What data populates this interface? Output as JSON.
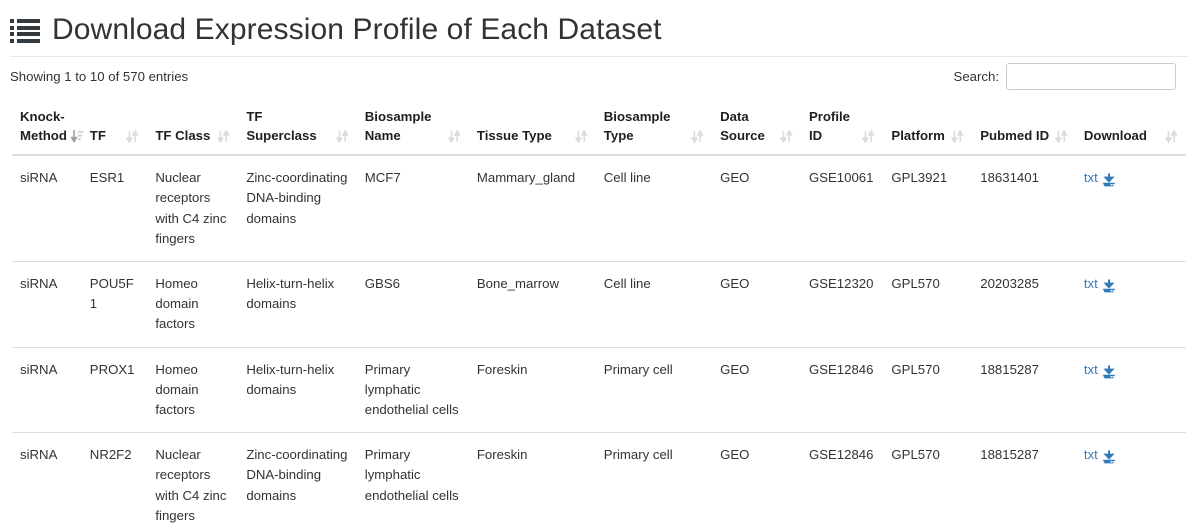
{
  "header": {
    "icon": "list-icon",
    "title": "Download Expression Profile of Each Dataset"
  },
  "table_controls": {
    "info": "Showing 1 to 10 of 570 entries",
    "search_label": "Search:",
    "search_value": "",
    "search_placeholder": ""
  },
  "table": {
    "columns": [
      {
        "label": "Knock-Method",
        "sort": "sort-amount-desc-icon",
        "sorted": true
      },
      {
        "label": "TF",
        "sort": "sort-icon",
        "sorted": false
      },
      {
        "label": "TF Class",
        "sort": "sort-icon",
        "sorted": false
      },
      {
        "label": "TF Superclass",
        "sort": "sort-icon",
        "sorted": false
      },
      {
        "label": "Biosample Name",
        "sort": "sort-icon",
        "sorted": false
      },
      {
        "label": "Tissue Type",
        "sort": "sort-icon",
        "sorted": false
      },
      {
        "label": "Biosample Type",
        "sort": "sort-icon",
        "sorted": false
      },
      {
        "label": "Data Source",
        "sort": "sort-icon",
        "sorted": false
      },
      {
        "label": "Profile ID",
        "sort": "sort-icon",
        "sorted": false
      },
      {
        "label": "Platform",
        "sort": "sort-icon",
        "sorted": false
      },
      {
        "label": "Pubmed ID",
        "sort": "sort-icon",
        "sorted": false
      },
      {
        "label": "Download",
        "sort": "sort-icon",
        "sorted": false
      }
    ],
    "rows": [
      {
        "knock_method": "siRNA",
        "tf": "ESR1",
        "tf_class": "Nuclear receptors with C4 zinc fingers",
        "tf_superclass": "Zinc-coordinating DNA-binding domains",
        "biosample_name": "MCF7",
        "tissue_type": "Mammary_gland",
        "biosample_type": "Cell line",
        "data_source": "GEO",
        "profile_id": "GSE10061",
        "platform": "GPL3921",
        "pubmed_id": "18631401",
        "download_label": "txt"
      },
      {
        "knock_method": "siRNA",
        "tf": "POU5F1",
        "tf_class": "Homeo domain factors",
        "tf_superclass": "Helix-turn-helix domains",
        "biosample_name": "GBS6",
        "tissue_type": "Bone_marrow",
        "biosample_type": "Cell line",
        "data_source": "GEO",
        "profile_id": "GSE12320",
        "platform": "GPL570",
        "pubmed_id": "20203285",
        "download_label": "txt"
      },
      {
        "knock_method": "siRNA",
        "tf": "PROX1",
        "tf_class": "Homeo domain factors",
        "tf_superclass": "Helix-turn-helix domains",
        "biosample_name": "Primary lymphatic endothelial cells",
        "tissue_type": "Foreskin",
        "biosample_type": "Primary cell",
        "data_source": "GEO",
        "profile_id": "GSE12846",
        "platform": "GPL570",
        "pubmed_id": "18815287",
        "download_label": "txt"
      },
      {
        "knock_method": "siRNA",
        "tf": "NR2F2",
        "tf_class": "Nuclear receptors with C4 zinc fingers",
        "tf_superclass": "Zinc-coordinating DNA-binding domains",
        "biosample_name": "Primary lymphatic endothelial cells",
        "tissue_type": "Foreskin",
        "biosample_type": "Primary cell",
        "data_source": "GEO",
        "profile_id": "GSE12846",
        "platform": "GPL570",
        "pubmed_id": "18815287",
        "download_label": "txt"
      }
    ]
  },
  "colors": {
    "link": "#337ab7",
    "text": "#333333",
    "header_text": "#1c2023",
    "border": "#dddddd",
    "sort_inactive": "#d8d8d8",
    "sort_active": "#a0a0a0"
  }
}
